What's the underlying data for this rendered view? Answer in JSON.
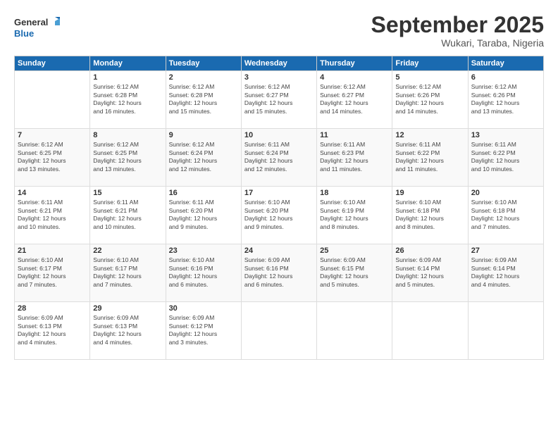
{
  "logo": {
    "line1": "General",
    "line2": "Blue"
  },
  "title": "September 2025",
  "subtitle": "Wukari, Taraba, Nigeria",
  "weekdays": [
    "Sunday",
    "Monday",
    "Tuesday",
    "Wednesday",
    "Thursday",
    "Friday",
    "Saturday"
  ],
  "weeks": [
    [
      {
        "day": "",
        "info": ""
      },
      {
        "day": "1",
        "info": "Sunrise: 6:12 AM\nSunset: 6:28 PM\nDaylight: 12 hours\nand 16 minutes."
      },
      {
        "day": "2",
        "info": "Sunrise: 6:12 AM\nSunset: 6:28 PM\nDaylight: 12 hours\nand 15 minutes."
      },
      {
        "day": "3",
        "info": "Sunrise: 6:12 AM\nSunset: 6:27 PM\nDaylight: 12 hours\nand 15 minutes."
      },
      {
        "day": "4",
        "info": "Sunrise: 6:12 AM\nSunset: 6:27 PM\nDaylight: 12 hours\nand 14 minutes."
      },
      {
        "day": "5",
        "info": "Sunrise: 6:12 AM\nSunset: 6:26 PM\nDaylight: 12 hours\nand 14 minutes."
      },
      {
        "day": "6",
        "info": "Sunrise: 6:12 AM\nSunset: 6:26 PM\nDaylight: 12 hours\nand 13 minutes."
      }
    ],
    [
      {
        "day": "7",
        "info": "Sunrise: 6:12 AM\nSunset: 6:25 PM\nDaylight: 12 hours\nand 13 minutes."
      },
      {
        "day": "8",
        "info": "Sunrise: 6:12 AM\nSunset: 6:25 PM\nDaylight: 12 hours\nand 13 minutes."
      },
      {
        "day": "9",
        "info": "Sunrise: 6:12 AM\nSunset: 6:24 PM\nDaylight: 12 hours\nand 12 minutes."
      },
      {
        "day": "10",
        "info": "Sunrise: 6:11 AM\nSunset: 6:24 PM\nDaylight: 12 hours\nand 12 minutes."
      },
      {
        "day": "11",
        "info": "Sunrise: 6:11 AM\nSunset: 6:23 PM\nDaylight: 12 hours\nand 11 minutes."
      },
      {
        "day": "12",
        "info": "Sunrise: 6:11 AM\nSunset: 6:22 PM\nDaylight: 12 hours\nand 11 minutes."
      },
      {
        "day": "13",
        "info": "Sunrise: 6:11 AM\nSunset: 6:22 PM\nDaylight: 12 hours\nand 10 minutes."
      }
    ],
    [
      {
        "day": "14",
        "info": "Sunrise: 6:11 AM\nSunset: 6:21 PM\nDaylight: 12 hours\nand 10 minutes."
      },
      {
        "day": "15",
        "info": "Sunrise: 6:11 AM\nSunset: 6:21 PM\nDaylight: 12 hours\nand 10 minutes."
      },
      {
        "day": "16",
        "info": "Sunrise: 6:11 AM\nSunset: 6:20 PM\nDaylight: 12 hours\nand 9 minutes."
      },
      {
        "day": "17",
        "info": "Sunrise: 6:10 AM\nSunset: 6:20 PM\nDaylight: 12 hours\nand 9 minutes."
      },
      {
        "day": "18",
        "info": "Sunrise: 6:10 AM\nSunset: 6:19 PM\nDaylight: 12 hours\nand 8 minutes."
      },
      {
        "day": "19",
        "info": "Sunrise: 6:10 AM\nSunset: 6:18 PM\nDaylight: 12 hours\nand 8 minutes."
      },
      {
        "day": "20",
        "info": "Sunrise: 6:10 AM\nSunset: 6:18 PM\nDaylight: 12 hours\nand 7 minutes."
      }
    ],
    [
      {
        "day": "21",
        "info": "Sunrise: 6:10 AM\nSunset: 6:17 PM\nDaylight: 12 hours\nand 7 minutes."
      },
      {
        "day": "22",
        "info": "Sunrise: 6:10 AM\nSunset: 6:17 PM\nDaylight: 12 hours\nand 7 minutes."
      },
      {
        "day": "23",
        "info": "Sunrise: 6:10 AM\nSunset: 6:16 PM\nDaylight: 12 hours\nand 6 minutes."
      },
      {
        "day": "24",
        "info": "Sunrise: 6:09 AM\nSunset: 6:16 PM\nDaylight: 12 hours\nand 6 minutes."
      },
      {
        "day": "25",
        "info": "Sunrise: 6:09 AM\nSunset: 6:15 PM\nDaylight: 12 hours\nand 5 minutes."
      },
      {
        "day": "26",
        "info": "Sunrise: 6:09 AM\nSunset: 6:14 PM\nDaylight: 12 hours\nand 5 minutes."
      },
      {
        "day": "27",
        "info": "Sunrise: 6:09 AM\nSunset: 6:14 PM\nDaylight: 12 hours\nand 4 minutes."
      }
    ],
    [
      {
        "day": "28",
        "info": "Sunrise: 6:09 AM\nSunset: 6:13 PM\nDaylight: 12 hours\nand 4 minutes."
      },
      {
        "day": "29",
        "info": "Sunrise: 6:09 AM\nSunset: 6:13 PM\nDaylight: 12 hours\nand 4 minutes."
      },
      {
        "day": "30",
        "info": "Sunrise: 6:09 AM\nSunset: 6:12 PM\nDaylight: 12 hours\nand 3 minutes."
      },
      {
        "day": "",
        "info": ""
      },
      {
        "day": "",
        "info": ""
      },
      {
        "day": "",
        "info": ""
      },
      {
        "day": "",
        "info": ""
      }
    ]
  ]
}
